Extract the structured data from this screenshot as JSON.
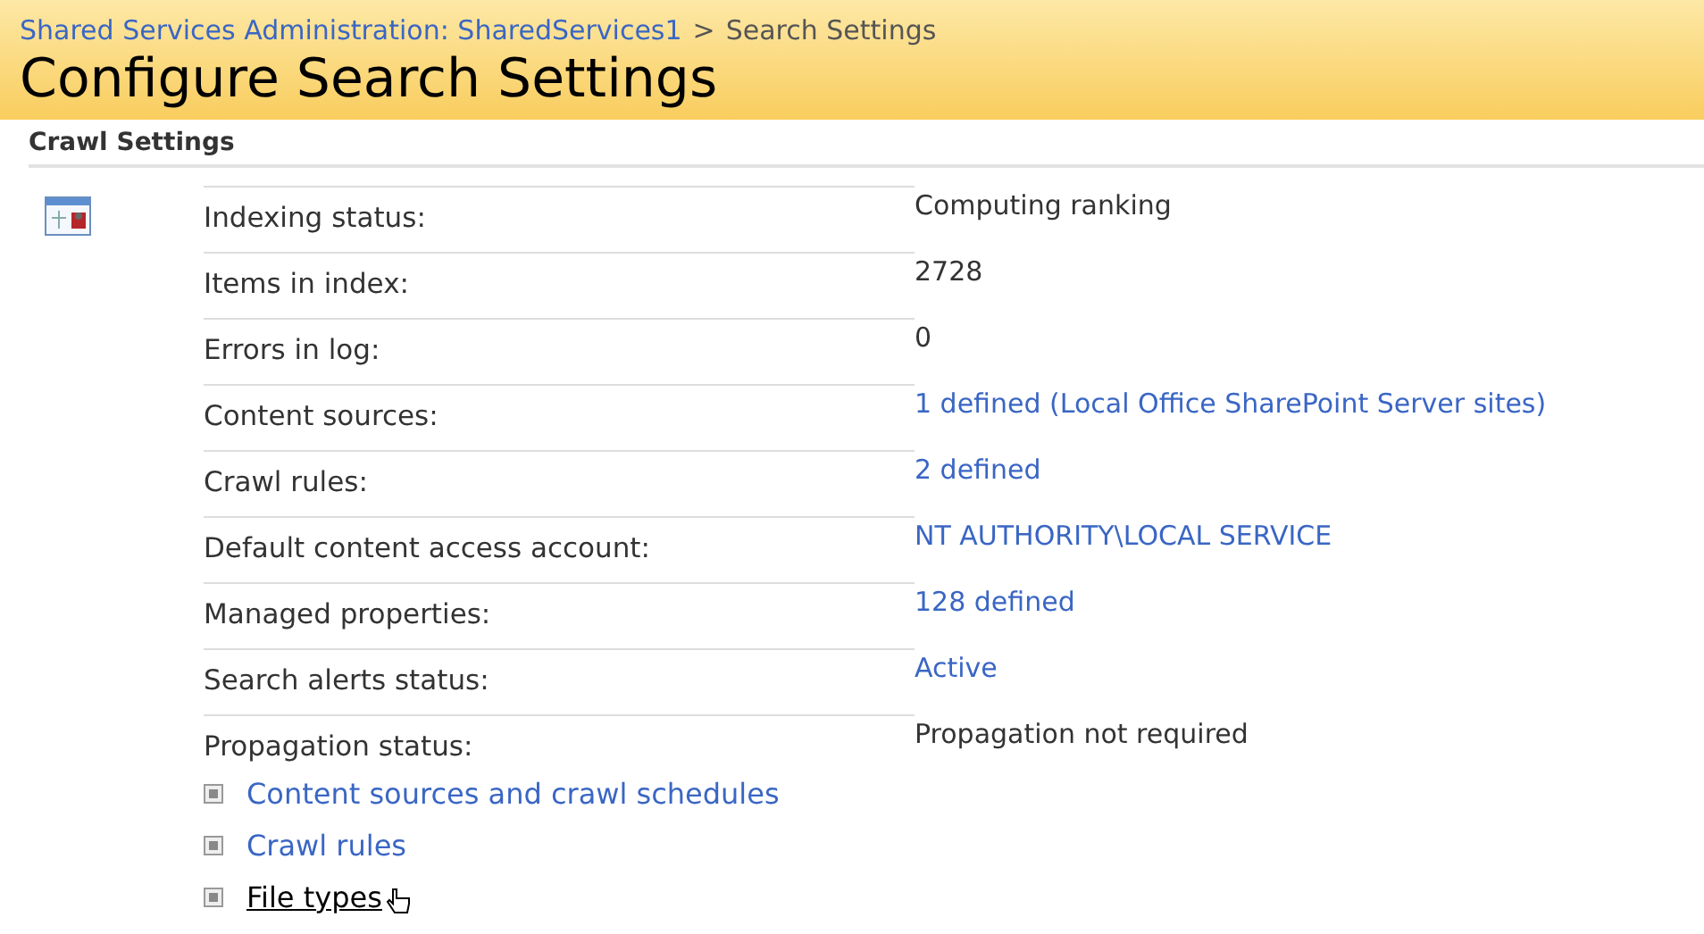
{
  "breadcrumb": {
    "parent": "Shared Services Administration: SharedServices1",
    "separator": ">",
    "current": "Search Settings"
  },
  "title": "Configure Search Settings",
  "section": {
    "title": "Crawl Settings"
  },
  "rows": [
    {
      "label": "Indexing status:",
      "value": "Computing ranking",
      "kind": "text"
    },
    {
      "label": "Items in index:",
      "value": "2728",
      "kind": "text"
    },
    {
      "label": "Errors in log:",
      "value": "0",
      "kind": "text"
    },
    {
      "label": "Content sources:",
      "value": "1 defined (Local Office SharePoint Server sites)",
      "kind": "link"
    },
    {
      "label": "Crawl rules:",
      "value": "2 defined",
      "kind": "link"
    },
    {
      "label": "Default content access account:",
      "value": "NT AUTHORITY\\LOCAL SERVICE",
      "kind": "link"
    },
    {
      "label": "Managed properties:",
      "value": "128 defined",
      "kind": "link"
    },
    {
      "label": "Search alerts status:",
      "value": "Active",
      "kind": "link"
    },
    {
      "label": "Propagation status:",
      "value": "Propagation not required",
      "kind": "text"
    }
  ],
  "links": [
    {
      "label": "Content sources and crawl schedules",
      "hovered": false
    },
    {
      "label": "Crawl rules",
      "hovered": false
    },
    {
      "label": "File types",
      "hovered": true
    }
  ]
}
